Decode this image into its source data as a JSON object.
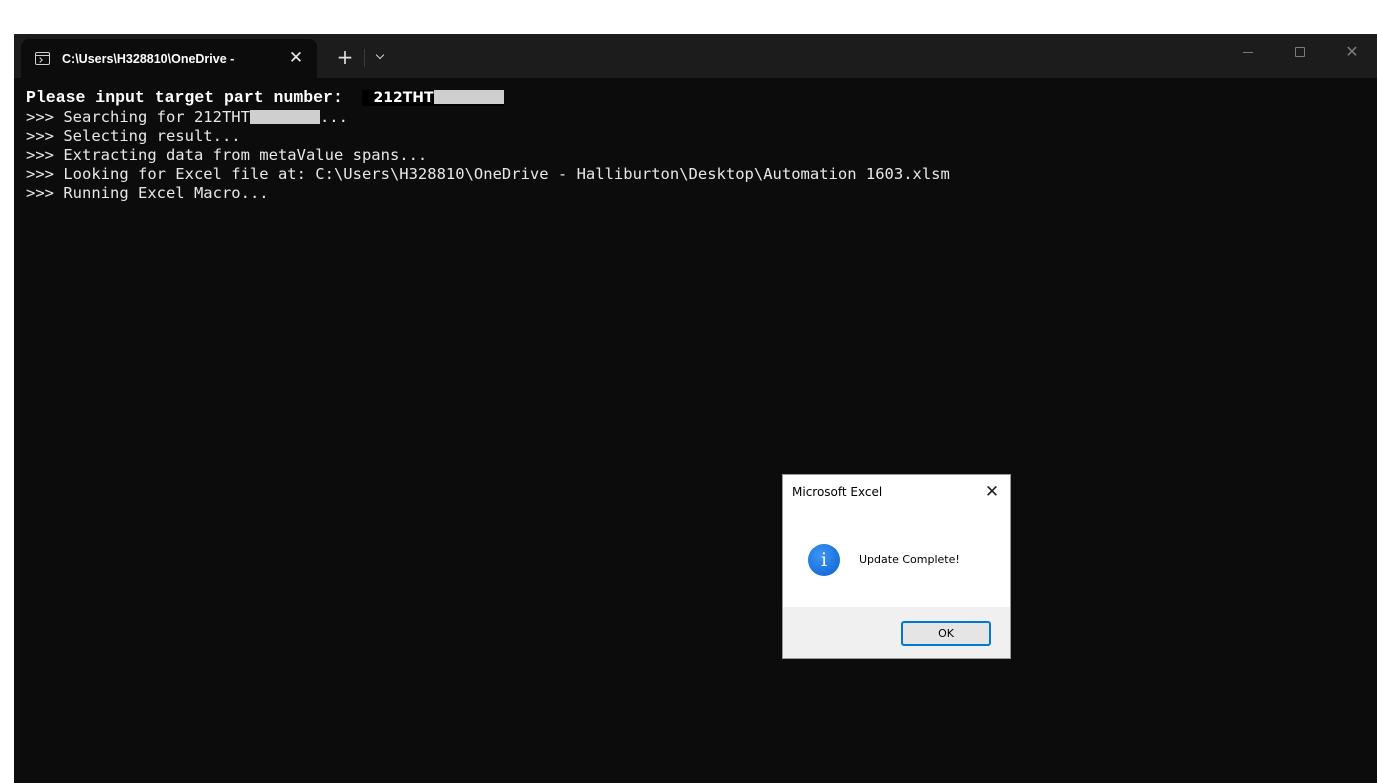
{
  "terminal": {
    "tab_title": "C:\\Users\\H328810\\OneDrive -",
    "tab_close_glyph": "✕",
    "new_tab_glyph": "+",
    "window_close_glyph": "✕",
    "background_color": "#0c0c0c",
    "text_color": "#e8e8e8",
    "prompt": {
      "label": "Please input target part number:",
      "value": "212THT"
    },
    "lines": [
      {
        "prefix": ">>> Searching for 212THT",
        "suffix": "..."
      },
      {
        "text": ">>> Selecting result..."
      },
      {
        "text": ">>> Extracting data from metaValue spans..."
      },
      {
        "text": ">>> Looking for Excel file at: C:\\Users\\H328810\\OneDrive - Halliburton\\Desktop\\Automation 1603.xlsm"
      },
      {
        "text": ">>> Running Excel Macro..."
      }
    ]
  },
  "dialog": {
    "title": "Microsoft Excel",
    "close_glyph": "✕",
    "icon": "info-icon",
    "icon_glyph": "i",
    "icon_color": "#1a73e8",
    "message": "Update Complete!",
    "ok_label": "OK",
    "accent_color": "#0078d4"
  }
}
